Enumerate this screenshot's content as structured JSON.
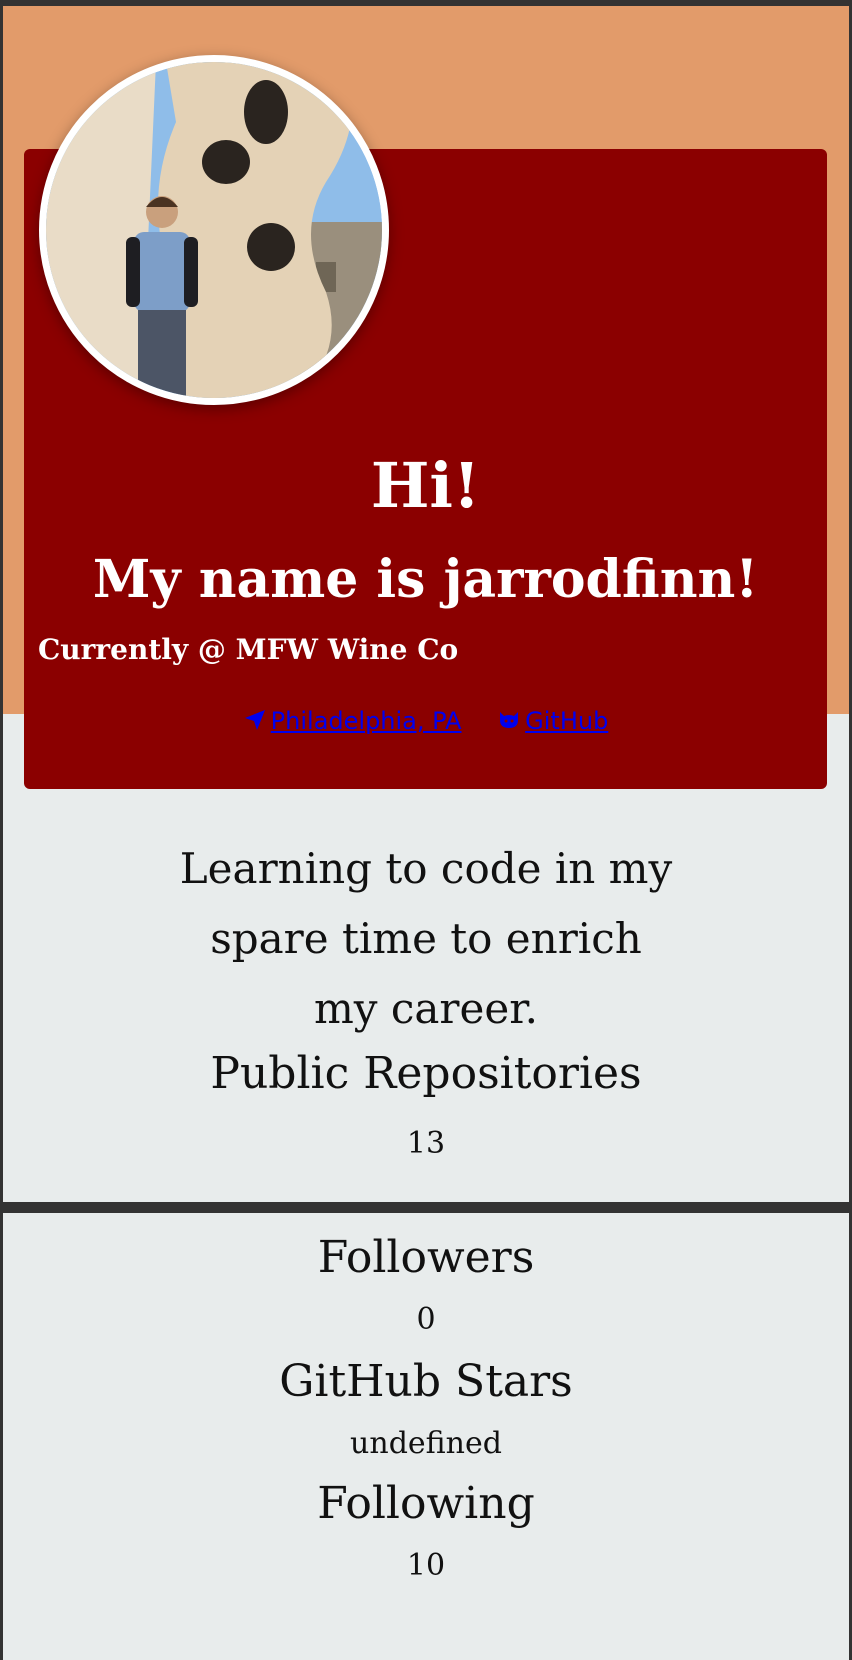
{
  "hero": {
    "greeting": "Hi!",
    "name_line": "My name is jarrodfinn!",
    "company_line": "Currently @ MFW Wine Co",
    "location_link": "Philadelphia, PA",
    "github_link": "GitHub"
  },
  "bio": {
    "line1": "Learning to code in my",
    "line2": "spare time to enrich",
    "line3": "my career."
  },
  "stats": {
    "repos_label": "Public Repositories",
    "repos_value": "13",
    "followers_label": "Followers",
    "followers_value": "0",
    "stars_label": "GitHub Stars",
    "stars_value": "undefined",
    "following_label": "Following",
    "following_value": "10"
  },
  "icons": {
    "location": "location-arrow-icon",
    "github": "github-icon"
  },
  "colors": {
    "top_band": "#e29b6a",
    "hero_bg": "#8b0000",
    "page_bg": "#e8ecec",
    "link": "#0000ee"
  }
}
